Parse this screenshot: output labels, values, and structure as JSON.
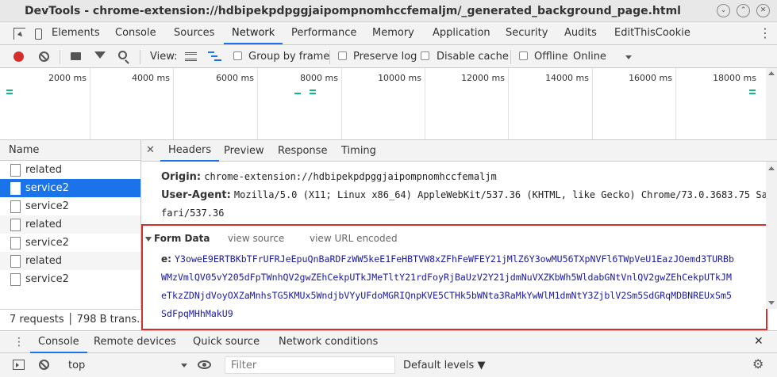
{
  "window": {
    "title": "DevTools - chrome-extension://hdbipekpdpggjaipompnomhccfemaljm/_generated_background_page.html"
  },
  "main_tabs": [
    "Elements",
    "Console",
    "Sources",
    "Network",
    "Performance",
    "Memory",
    "Application",
    "Security",
    "Audits",
    "EditThisCookie"
  ],
  "active_main_tab": "Network",
  "toolbar": {
    "view_label": "View:",
    "group_by_frame": "Group by frame",
    "preserve_log": "Preserve log",
    "disable_cache": "Disable cache",
    "offline": "Offline",
    "throttle": "Online"
  },
  "overview": {
    "ticks": [
      "2000 ms",
      "4000 ms",
      "6000 ms",
      "8000 ms",
      "10000 ms",
      "12000 ms",
      "14000 ms",
      "16000 ms",
      "18000 ms"
    ]
  },
  "requests": {
    "header": "Name",
    "items": [
      "related",
      "service2",
      "service2",
      "related",
      "service2",
      "related",
      "service2"
    ],
    "selected_index": 1,
    "summary": "7 requests │ 798 B trans..."
  },
  "detail": {
    "tabs": [
      "Headers",
      "Preview",
      "Response",
      "Timing"
    ],
    "active_tab": "Headers",
    "origin_label": "Origin:",
    "origin_value": "chrome-extension://hdbipekpdpggjaipompnomhccfemaljm",
    "ua_label": "User-Agent:",
    "ua_value_line1": "Mozilla/5.0 (X11; Linux x86_64) AppleWebKit/537.36 (KHTML, like Gecko) Chrome/73.0.3683.75 Sa",
    "ua_value_line2": "fari/537.36",
    "form_data_title": "Form Data",
    "view_source": "view source",
    "view_url_encoded": "view URL encoded",
    "form_key": "e:",
    "form_value_lines": [
      "Y3oweE9ERTBKbTFrUFRJeEpuQnBaRDFzWW5keE1FeHBTVW8xZFhFeWFEY21jMlZ6Y3owMU56TXpNVFl6TWpVeU1EazJOemd3TURBb",
      "WMzVmlQV05vY205dFpTWnhQV2gwZEhCekpUTkJMeTltY21rdFoyRjBaUzV2Y21jdmNuVXZKbWh5WldabGNtVnlQV2gwZEhCekpUTkJM",
      "eTkzZDNjdVoyOXZaMnhsTG5KMUx5WndjbVYyUFdoMGRIQnpKVE5CTHk5bWNta3RaMkYwWlM1dmNtY3ZjblV2Sm5SdGRqMDBNREUxSm5",
      "SdFpqMHhMakU9"
    ]
  },
  "drawer": {
    "tabs": [
      "Console",
      "Remote devices",
      "Quick source",
      "Network conditions"
    ],
    "active_tab": "Console",
    "context": "top",
    "filter_placeholder": "Filter",
    "levels": "Default levels ▼"
  },
  "colors": {
    "accent": "#1a73e8",
    "record_red": "#d32f2f",
    "highlight_box": "#d32f2f"
  }
}
